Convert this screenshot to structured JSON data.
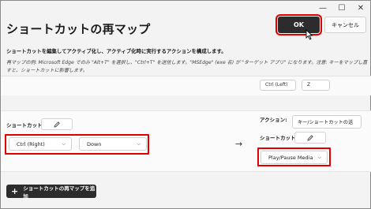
{
  "window": {
    "controls": {
      "minimize": "—",
      "maximize": "☐",
      "close": "✕"
    }
  },
  "header": {
    "title": "ショートカットの再マップ",
    "ok_label": "OK",
    "cancel_label": "キャンセル"
  },
  "description": "ショートカットを編集してアクティブ化し、アクティブ化時に実行するアクションを構成します。",
  "example": "再マップの例: Microsoft Edge でのみ \"Alt+T\" を選択し、\"Ctrl+T\" を送信します。\"MSEdge\" (exe 名) が \"ターゲット アプリ\" になります。注意: キーをマップし直すと、ショートカットに影響します。",
  "previous_row": {
    "key_value": "Ctrl (Left)",
    "second_value": "Z"
  },
  "mapping": {
    "shortcut_label": "ショートカット:",
    "keys": [
      {
        "value": "Ctrl (Right)"
      },
      {
        "value": "Down"
      }
    ],
    "action_label": "アクション:",
    "action_type": "キー/ショートカットの送",
    "target_shortcut_label": "ショートカット:",
    "target_value": "Play/Pause Media",
    "arrow": "→"
  },
  "footer": {
    "add_label": "ショートカットの再マップを追加",
    "add_icon": "+"
  },
  "colors": {
    "highlight": "#e00000",
    "primary_button": "#2c2c2c"
  }
}
